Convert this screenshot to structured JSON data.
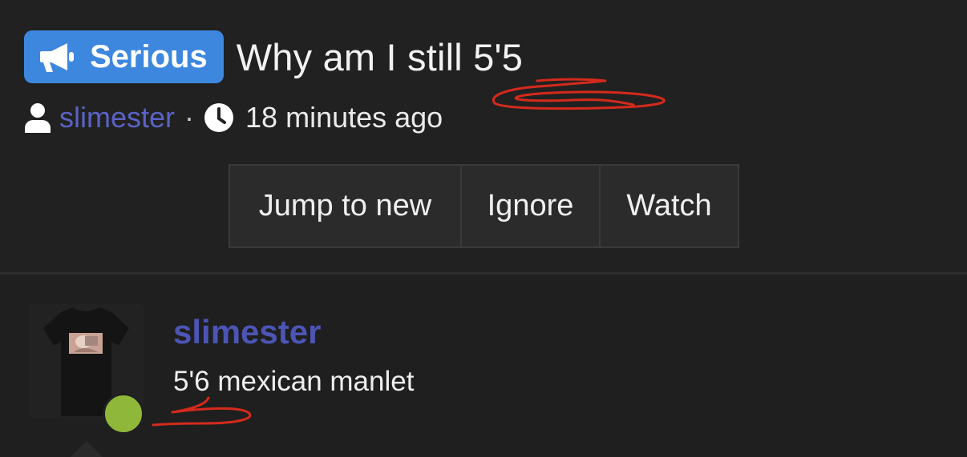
{
  "thread": {
    "prefix": "Serious",
    "title": "Why am I still 5'5",
    "author": "slimester",
    "separator": "·",
    "time_ago": "18 minutes ago"
  },
  "actions": {
    "jump_to_new": "Jump to new",
    "ignore": "Ignore",
    "watch": "Watch"
  },
  "post": {
    "username": "slimester",
    "user_title": "5'6 mexican manlet",
    "online": true
  },
  "colors": {
    "prefix_badge": "#3d87de",
    "author_link": "#5a63c4",
    "online_dot": "#8fb83a",
    "annotation_scribble": "#d42a1c",
    "background": "#212121"
  },
  "icons": {
    "prefix": "megaphone-icon",
    "author": "user-icon",
    "time": "clock-icon"
  }
}
